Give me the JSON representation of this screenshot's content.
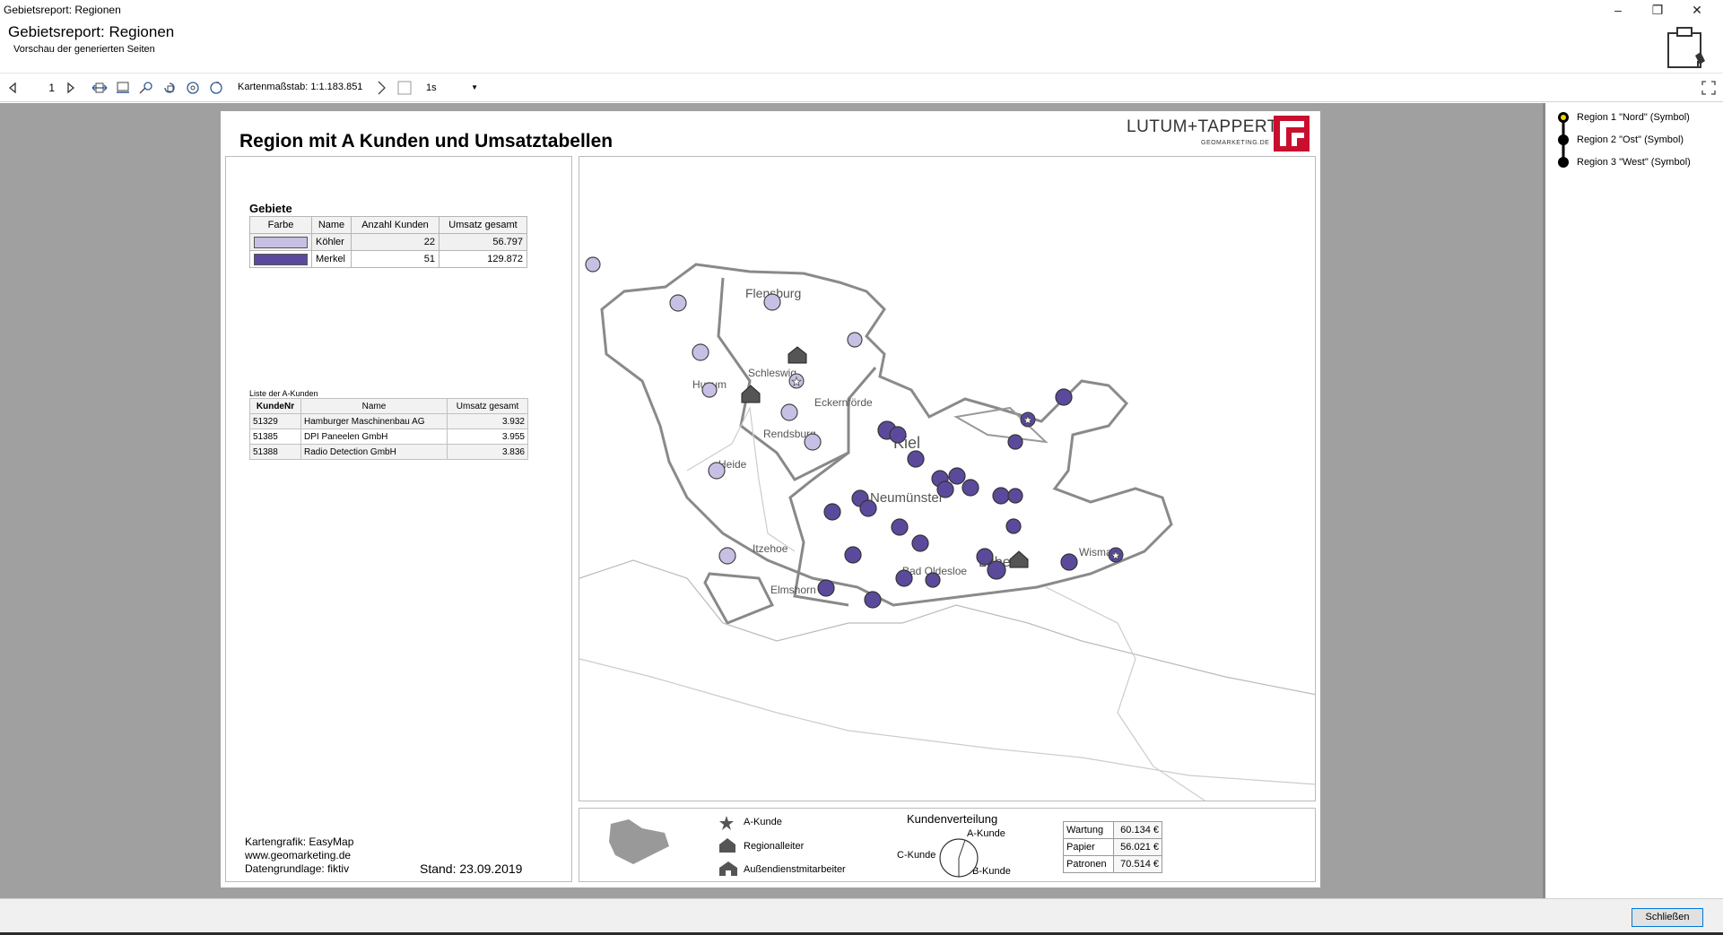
{
  "window": {
    "title": "Gebietsreport: Regionen",
    "header_title": "Gebietsreport: Regionen",
    "header_subtitle": "Vorschau der generierten Seiten"
  },
  "toolbar": {
    "page_number": "1",
    "scale_label": "Kartenmaßstab: 1:1.183.851",
    "zoom_value": "1s"
  },
  "report": {
    "title": "Region mit A Kunden und Umsatztabellen",
    "logo_text": "LUTUM+TAPPERT",
    "logo_sub": "GEOMARKETING.DE",
    "gebiete": {
      "heading": "Gebiete",
      "columns": [
        "Farbe",
        "Name",
        "Anzahl Kunden",
        "Umsatz gesamt"
      ],
      "rows": [
        {
          "color": "#c8c0e4",
          "name": "Köhler",
          "count": "22",
          "total": "56.797"
        },
        {
          "color": "#5b4a9b",
          "name": "Merkel",
          "count": "51",
          "total": "129.872"
        }
      ]
    },
    "kunden": {
      "heading": "Liste der A-Kunden",
      "columns": [
        "KundeNr",
        "Name",
        "Umsatz gesamt"
      ],
      "rows": [
        {
          "nr": "51329",
          "name": "Hamburger Maschinenbau AG",
          "total": "3.932"
        },
        {
          "nr": "51385",
          "name": "DPI Paneelen GmbH",
          "total": "3.955"
        },
        {
          "nr": "51388",
          "name": "Radio Detection GmbH",
          "total": "3.836"
        }
      ]
    },
    "credits": {
      "line1": "Kartengrafik: EasyMap",
      "line2": "www.geomarketing.de",
      "line3": "Datengrundlage: fiktiv"
    },
    "stand": "Stand: 23.09.2019",
    "map_labels": {
      "flensburg": "Flensburg",
      "schleswig": "Schleswig",
      "husum": "Husum",
      "eckernfoerde": "Eckernförde",
      "rendsburg": "Rendsburg",
      "heide": "Heide",
      "kiel": "Kiel",
      "neumuenster": "Neumünster",
      "itzehoe": "Itzehoe",
      "elmshorn": "Elmshorn",
      "bad_oldesloe": "Bad Oldesloe",
      "luebeck": "Lübeck",
      "wismar": "Wismar"
    },
    "legend": {
      "a_kunde": "A-Kunde",
      "regionalleiter": "Regionalleiter",
      "aussendienst": "Außendienstmitarbeiter",
      "verteilung_title": "Kundenverteilung",
      "a_label": "A-Kunde",
      "b_label": "B-Kunde",
      "c_label": "C-Kunde",
      "categories": [
        {
          "name": "Wartung",
          "value": "60.134 €"
        },
        {
          "name": "Papier",
          "value": "56.021 €"
        },
        {
          "name": "Patronen",
          "value": "70.514 €"
        }
      ]
    }
  },
  "sidebar": {
    "items": [
      {
        "label": "Region 1 \"Nord\" (Symbol)"
      },
      {
        "label": "Region 2 \"Ost\" (Symbol)"
      },
      {
        "label": "Region 3 \"West\" (Symbol)"
      }
    ]
  },
  "footer": {
    "close_label": "Schließen"
  },
  "colors": {
    "koehler": "#c8c0e4",
    "merkel": "#5b4a9b",
    "logo_red": "#c8102e",
    "workspace": "#a0a0a0"
  }
}
